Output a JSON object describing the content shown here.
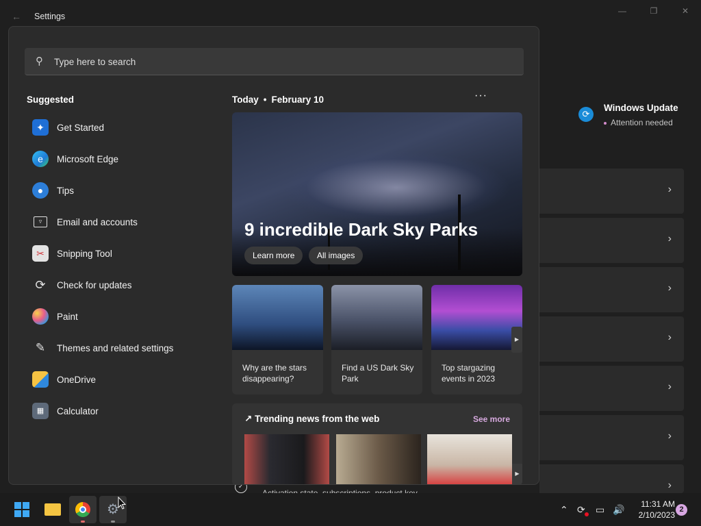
{
  "window": {
    "title": "Settings",
    "back_icon": "arrow-left-icon",
    "minimize_icon": "minimize-icon",
    "maximize_icon": "maximize-icon",
    "close_icon": "close-icon"
  },
  "windows_update": {
    "title": "Windows Update",
    "status": "Attention needed"
  },
  "bottom_hint": {
    "text": "Activation state, subscriptions, product key"
  },
  "search": {
    "placeholder": "Type here to search"
  },
  "suggested": {
    "title": "Suggested",
    "items": [
      {
        "label": "Get Started",
        "icon": "get-started-icon"
      },
      {
        "label": "Microsoft Edge",
        "icon": "edge-icon"
      },
      {
        "label": "Tips",
        "icon": "lightbulb-icon"
      },
      {
        "label": "Email and accounts",
        "icon": "mail-icon"
      },
      {
        "label": "Snipping Tool",
        "icon": "scissors-icon"
      },
      {
        "label": "Check for updates",
        "icon": "refresh-icon"
      },
      {
        "label": "Paint",
        "icon": "palette-icon"
      },
      {
        "label": "Themes and related settings",
        "icon": "brush-icon"
      },
      {
        "label": "OneDrive",
        "icon": "cloud-icon"
      },
      {
        "label": "Calculator",
        "icon": "calculator-icon"
      }
    ]
  },
  "today": {
    "label": "Today",
    "date": "February 10"
  },
  "hero": {
    "title": "9 incredible Dark Sky Parks",
    "learn_more": "Learn more",
    "all_images": "All images"
  },
  "cards": [
    {
      "caption": "Why are the stars disappearing?"
    },
    {
      "caption": "Find a US Dark Sky Park"
    },
    {
      "caption": "Top stargazing events in 2023"
    }
  ],
  "trending": {
    "title": "Trending news from the web",
    "see_more": "See more"
  },
  "taskbar": {
    "clock_time": "11:31 AM",
    "clock_date": "2/10/2023",
    "notification_count": "2"
  }
}
